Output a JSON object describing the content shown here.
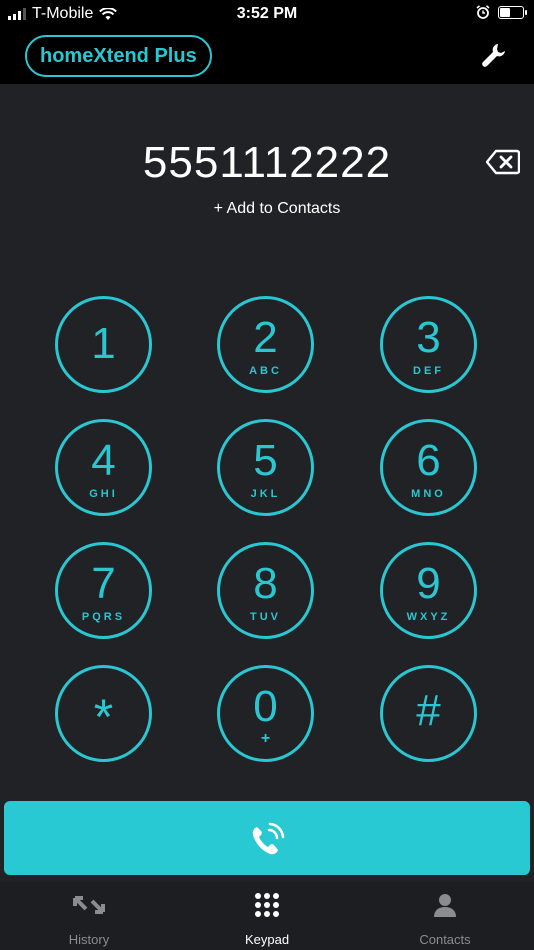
{
  "status_bar": {
    "carrier": "T-Mobile",
    "time": "3:52 PM"
  },
  "header": {
    "app_name": "homeXtend Plus",
    "settings_icon": "wrench-icon"
  },
  "dialer": {
    "number": "5551112222",
    "add_contacts": "+ Add to Contacts",
    "backspace_icon": "backspace-icon"
  },
  "keypad": {
    "keys": [
      {
        "digit": "1",
        "letters": ""
      },
      {
        "digit": "2",
        "letters": "ABC"
      },
      {
        "digit": "3",
        "letters": "DEF"
      },
      {
        "digit": "4",
        "letters": "GHI"
      },
      {
        "digit": "5",
        "letters": "JKL"
      },
      {
        "digit": "6",
        "letters": "MNO"
      },
      {
        "digit": "7",
        "letters": "PQRS"
      },
      {
        "digit": "8",
        "letters": "TUV"
      },
      {
        "digit": "9",
        "letters": "WXYZ"
      },
      {
        "digit": "*",
        "letters": ""
      },
      {
        "digit": "0",
        "letters": "+"
      },
      {
        "digit": "#",
        "letters": ""
      }
    ]
  },
  "call_button": {
    "icon": "phone-call-icon"
  },
  "tabs": [
    {
      "label": "History",
      "icon": "history-icon",
      "active": false
    },
    {
      "label": "Keypad",
      "icon": "keypad-icon",
      "active": true
    },
    {
      "label": "Contacts",
      "icon": "contacts-icon",
      "active": false
    }
  ],
  "colors": {
    "accent": "#2ac6d1",
    "background": "#202225",
    "header": "#000000"
  }
}
